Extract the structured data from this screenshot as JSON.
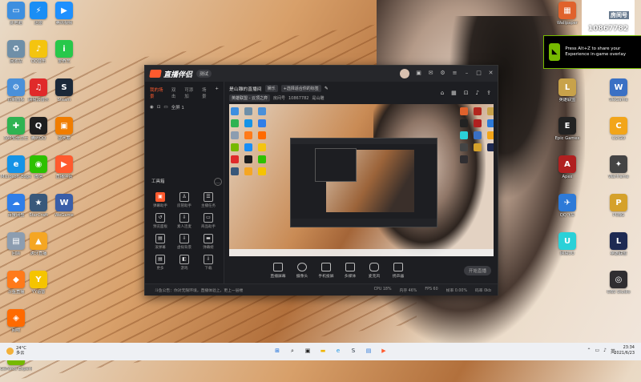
{
  "desktop": {
    "left_icons": [
      {
        "label": "此电脑",
        "icon": "computer-icon",
        "color": "#3d8fe0",
        "glyph": "▭"
      },
      {
        "label": "回收站",
        "icon": "recycle-bin-icon",
        "color": "#6f8fa8",
        "glyph": "♻"
      },
      {
        "label": "控制面板",
        "icon": "control-panel-icon",
        "color": "#4a90d9",
        "glyph": "⚙"
      },
      {
        "label": "360安全卫士",
        "icon": "security-guard-icon",
        "color": "#2fb352",
        "glyph": "✚"
      },
      {
        "label": "Microsoft Edge",
        "icon": "edge-icon",
        "color": "#1593e6",
        "glyph": "e"
      },
      {
        "label": "百度网盘",
        "icon": "baidu-netdisk-icon",
        "color": "#2f7ee8",
        "glyph": "☁"
      },
      {
        "label": "回顾",
        "icon": "review-icon",
        "color": "#8c9db0",
        "glyph": "▤"
      },
      {
        "label": "斗鱼直播",
        "icon": "douyu-icon",
        "color": "#ff7a1a",
        "glyph": "◆"
      },
      {
        "label": "网吧",
        "icon": "netcafe-icon",
        "color": "#ff6a00",
        "glyph": "◈"
      },
      {
        "label": "GeForce Experience",
        "icon": "geforce-icon",
        "color": "#76b900",
        "glyph": "◣"
      }
    ],
    "left_icons2": [
      {
        "label": "迅雷",
        "icon": "thunder-icon",
        "color": "#1a8ef5",
        "glyph": "⚡"
      },
      {
        "label": "QQ音乐",
        "icon": "qq-music-icon",
        "color": "#f4c40f",
        "glyph": "♪"
      },
      {
        "label": "网易云音乐",
        "icon": "netease-music-icon",
        "color": "#e02a2a",
        "glyph": "♫"
      },
      {
        "label": "腾讯QQ",
        "icon": "qq-icon",
        "color": "#1e1e1e",
        "glyph": "Q"
      },
      {
        "label": "微信",
        "icon": "wechat-icon",
        "color": "#2dc100",
        "glyph": "◉"
      },
      {
        "label": "StarCraft",
        "icon": "game-icon",
        "color": "#39587a",
        "glyph": "★"
      },
      {
        "label": "虎牙直播",
        "icon": "huya-icon",
        "color": "#f5a623",
        "glyph": "▲"
      },
      {
        "label": "YY语音",
        "icon": "yy-icon",
        "color": "#f5c400",
        "glyph": "Y"
      }
    ],
    "left_icons3": [
      {
        "label": "腾讯视频",
        "icon": "tencent-video-icon",
        "color": "#1e90ff",
        "glyph": "▶"
      },
      {
        "label": "爱奇艺",
        "icon": "iqiyi-icon",
        "color": "#28c84a",
        "glyph": "i"
      },
      {
        "label": "Steam",
        "icon": "steam-icon",
        "color": "#1b2838",
        "glyph": "S"
      },
      {
        "label": "逆水寒",
        "icon": "game2-icon",
        "color": "#f07d00",
        "glyph": "▣"
      },
      {
        "label": "直播伴侣",
        "icon": "live-companion-icon",
        "color": "#ff5a2e",
        "glyph": "▶"
      },
      {
        "label": "WeGame",
        "icon": "wegame-icon",
        "color": "#3a5ea8",
        "glyph": "W"
      }
    ],
    "right_icons": [
      {
        "label": "Wallpaper",
        "icon": "wallpaper-icon",
        "color": "#e0622c",
        "glyph": "▦"
      },
      {
        "label": "Dota 2",
        "icon": "dota-icon",
        "color": "#b3261e",
        "glyph": "D"
      },
      {
        "label": "英雄联盟",
        "icon": "lol-icon",
        "color": "#c8a24a",
        "glyph": "L"
      },
      {
        "label": "Epic Games",
        "icon": "epic-icon",
        "color": "#222222",
        "glyph": "E"
      },
      {
        "label": "Apex",
        "icon": "apex-icon",
        "color": "#b02020",
        "glyph": "A"
      },
      {
        "label": "QQ飞车",
        "icon": "speed-icon",
        "color": "#2d7ad8",
        "glyph": "✈"
      },
      {
        "label": "网易UU",
        "icon": "uu-icon",
        "color": "#2ad1d8",
        "glyph": "U"
      }
    ],
    "right_icons2": [
      {
        "label": "WeGame",
        "icon": "wegame2-icon",
        "color": "#3a70c4",
        "glyph": "W"
      },
      {
        "label": "CS:GO",
        "icon": "csgo-icon",
        "color": "#f2a51a",
        "glyph": "C"
      },
      {
        "label": "Warframe",
        "icon": "warframe-icon",
        "color": "#444444",
        "glyph": "✦"
      },
      {
        "label": "PUBG",
        "icon": "pubg-icon",
        "color": "#d5a12b",
        "glyph": "P"
      },
      {
        "label": "英雄联盟",
        "icon": "lol2-icon",
        "color": "#1e2a52",
        "glyph": "L"
      },
      {
        "label": "OBS Studio",
        "icon": "obs-icon",
        "color": "#302e31",
        "glyph": "◎"
      }
    ]
  },
  "overlay": {
    "room_label": "房间号",
    "room_id": "10867782",
    "nvidia_message": "Press Alt+Z to share your Experience in-game overlay"
  },
  "app": {
    "title": "直播伴侣",
    "version_pill": "测试",
    "tabs": [
      "我的场景",
      "双击",
      "可添加",
      "场景"
    ],
    "scene_item": "全屏 1",
    "room_title": "是山雕的直播间",
    "room_chip1": "娱乐",
    "room_chip2": "+选择适合你的标签",
    "room_sub1": "英雄联盟 - 云顶之弈",
    "room_sub2": "房间号",
    "room_id": "10867782",
    "room_sub3": "是山雕",
    "tools_header": "工具箱",
    "tools": [
      {
        "label": "弹幕助手",
        "hot": true,
        "glyph": "▣"
      },
      {
        "label": "房管助手",
        "hot": false,
        "glyph": "♙"
      },
      {
        "label": "主播任务",
        "hot": false,
        "glyph": "☰"
      },
      {
        "label": "预览面板",
        "hot": false,
        "glyph": "↺"
      },
      {
        "label": "素人连麦",
        "hot": false,
        "glyph": "⇩"
      },
      {
        "label": "商品助手",
        "hot": false,
        "glyph": "▭"
      },
      {
        "label": "滚弹幕",
        "hot": false,
        "glyph": "▤"
      },
      {
        "label": "虚拟背景",
        "hot": false,
        "glyph": "⇩"
      },
      {
        "label": "弹幕姬",
        "hot": false,
        "glyph": "▬"
      },
      {
        "label": "更多",
        "hot": false,
        "glyph": "▤"
      },
      {
        "label": "游戏",
        "hot": false,
        "glyph": "◧"
      },
      {
        "label": "下载",
        "hot": false,
        "glyph": "⇩"
      }
    ],
    "bottom_buttons": [
      "直播屏幕",
      "摄像头",
      "手机投屏",
      "多媒体",
      "麦克风",
      "扬声器"
    ],
    "go_live": "开始直播",
    "status_message": "斗鱼公告：你对无限环境，直播体验上，更上一层楼",
    "stats": [
      "CPU 18%",
      "内存 46%",
      "FPS 60",
      "帧率 0.00%",
      "码率 0kb"
    ]
  },
  "taskbar": {
    "weather_temp": "24°C",
    "weather_desc": "多云",
    "time": "23:34",
    "date": "2021/6/23",
    "tray_text": "英"
  }
}
